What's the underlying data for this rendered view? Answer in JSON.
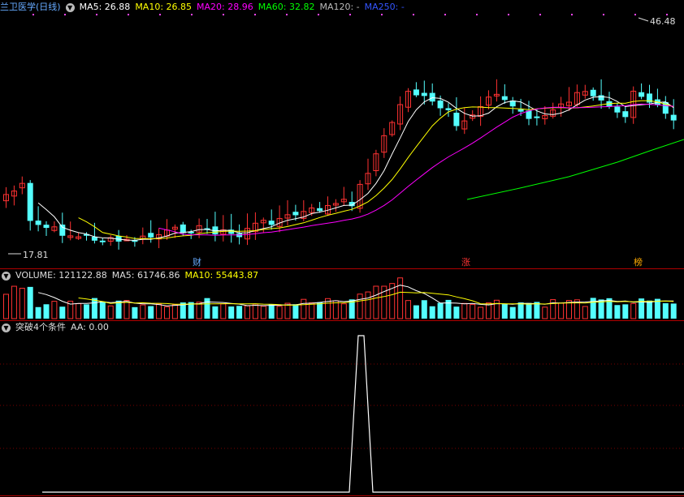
{
  "main": {
    "title": "兰卫医学(日线)",
    "ma": [
      {
        "label": "MA5: 26.88",
        "color": "#ffffff"
      },
      {
        "label": "MA10: 26.85",
        "color": "#ffff00"
      },
      {
        "label": "MA20: 28.96",
        "color": "#ff00ff"
      },
      {
        "label": "MA60: 32.82",
        "color": "#00ff00"
      },
      {
        "label": "MA120: -",
        "color": "#bbbbbb"
      },
      {
        "label": "MA250: -",
        "color": "#3355ff"
      }
    ],
    "high_label": "46.48",
    "low_label": "17.81",
    "tags": [
      {
        "text": "财",
        "color": "#66aaff"
      },
      {
        "text": "涨",
        "color": "#ff3333"
      },
      {
        "text": "榜",
        "color": "#ffaa00"
      }
    ]
  },
  "volume": {
    "label": "VOLUME: 121122.88",
    "ma5": "MA5: 61746.86",
    "ma10": "MA10: 55443.87"
  },
  "indicator": {
    "label": "突破4个条件",
    "aa": "AA: 0.00"
  },
  "colors": {
    "up": "#ff3232",
    "down": "#54ffff",
    "border": "#b00000",
    "ma5": "#ffffff",
    "ma10": "#ffff00",
    "ma20": "#ff00ff",
    "ma60": "#00ff00"
  }
}
